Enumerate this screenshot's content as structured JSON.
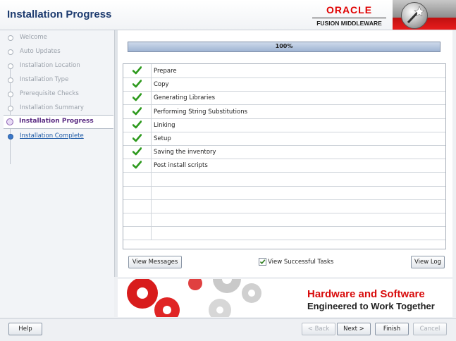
{
  "header": {
    "title": "Installation Progress",
    "brand": "ORACLE",
    "product": "FUSION MIDDLEWARE"
  },
  "sidebar": {
    "steps": [
      {
        "label": "Welcome",
        "state": "done"
      },
      {
        "label": "Auto Updates",
        "state": "done"
      },
      {
        "label": "Installation Location",
        "state": "done"
      },
      {
        "label": "Installation Type",
        "state": "done"
      },
      {
        "label": "Prerequisite Checks",
        "state": "done"
      },
      {
        "label": "Installation Summary",
        "state": "done"
      },
      {
        "label": "Installation Progress",
        "state": "current"
      },
      {
        "label": "Installation Complete",
        "state": "next"
      }
    ]
  },
  "progress": {
    "percent": 100,
    "text": "100%"
  },
  "tasks": [
    {
      "name": "Prepare",
      "status": "success"
    },
    {
      "name": "Copy",
      "status": "success"
    },
    {
      "name": "Generating Libraries",
      "status": "success"
    },
    {
      "name": "Performing String Substitutions",
      "status": "success"
    },
    {
      "name": "Linking",
      "status": "success"
    },
    {
      "name": "Setup",
      "status": "success"
    },
    {
      "name": "Saving the inventory",
      "status": "success"
    },
    {
      "name": "Post install scripts",
      "status": "success"
    }
  ],
  "actions": {
    "view_messages": "View Messages",
    "view_successful_tasks": "View Successful Tasks",
    "view_successful_checked": true,
    "view_log": "View Log"
  },
  "banner": {
    "line1": "Hardware and Software",
    "line2": "Engineered to Work Together"
  },
  "footer": {
    "help": "Help",
    "back": "< Back",
    "next": "Next >",
    "finish": "Finish",
    "cancel": "Cancel"
  },
  "colors": {
    "accent": "#d80b0b",
    "check": "#2e9a1e",
    "current_step": "#5b2c83"
  }
}
